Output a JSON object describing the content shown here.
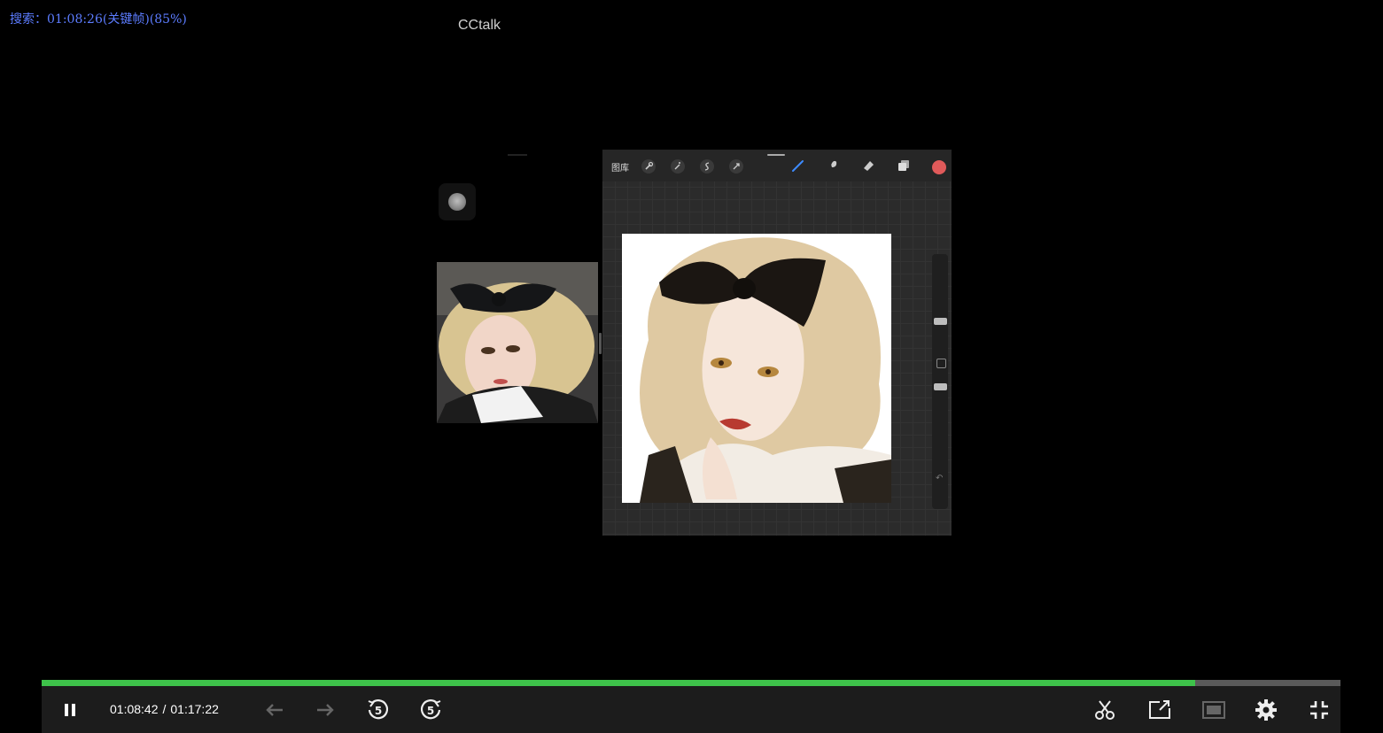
{
  "overlay": {
    "search_text": "搜索：01:08:26(关键帧)(85%)",
    "window_title": "CCtalk"
  },
  "procreate": {
    "gallery_label": "图库",
    "current_color": "#e05a5a"
  },
  "player": {
    "current_time": "01:08:42",
    "time_separator": "/",
    "total_time": "01:17:22",
    "progress_fraction": 0.8878,
    "progress_color": "#3ec24a",
    "controls": {
      "play_pause": "pause-icon",
      "previous": "arrow-left-icon",
      "next": "arrow-right-icon",
      "rewind": "rewind-5-icon",
      "forward": "forward-5-icon",
      "clip": "scissors-icon",
      "share": "share-screen-icon",
      "mini": "picture-in-picture-icon",
      "settings": "gear-icon",
      "exit_fullscreen": "exit-fullscreen-icon"
    }
  }
}
